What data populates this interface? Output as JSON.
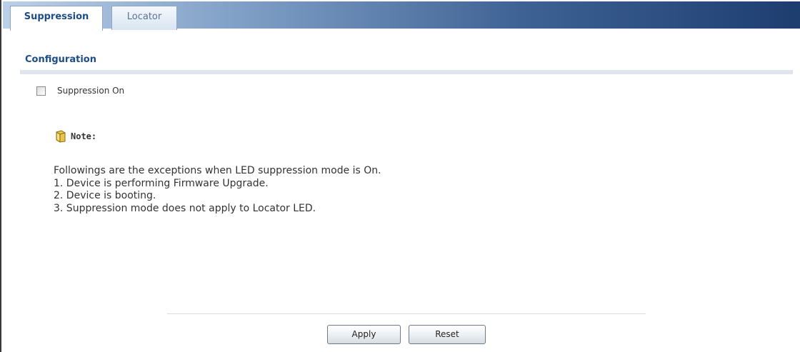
{
  "tabs": [
    {
      "label": "Suppression",
      "active": true
    },
    {
      "label": "Locator",
      "active": false
    }
  ],
  "configuration": {
    "title": "Configuration",
    "suppression_checkbox": {
      "label": "Suppression On",
      "checked": false
    }
  },
  "note": {
    "icon": "note-icon",
    "label": "Note:",
    "lines": [
      "Followings are the exceptions when LED suppression mode is On.",
      "1. Device is performing Firmware Upgrade.",
      "2. Device is booting.",
      "3. Suppression mode does not apply to Locator LED."
    ]
  },
  "buttons": {
    "apply_label": "Apply",
    "reset_label": "Reset"
  },
  "colors": {
    "accent": "#1d4d86",
    "tab_bar_dark": "#1d3d6f"
  }
}
